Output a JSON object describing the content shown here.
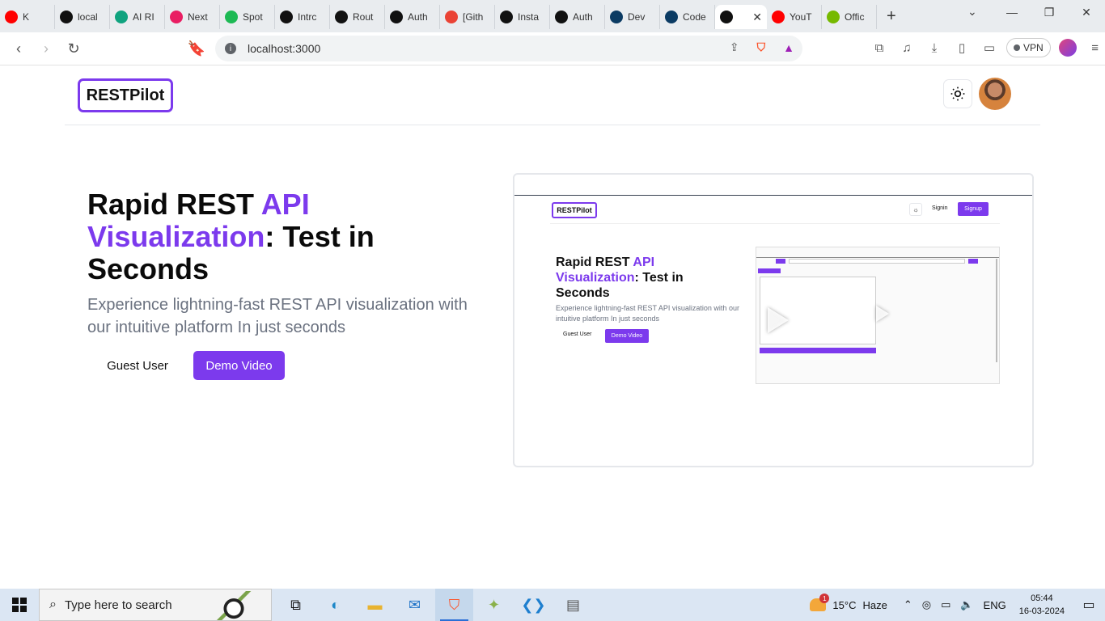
{
  "browser": {
    "tabs": [
      {
        "label": "K",
        "icon": "youtube-icon",
        "color": "#ff0000"
      },
      {
        "label": "local",
        "icon": "vercel-icon",
        "color": "#111111"
      },
      {
        "label": "AI RI",
        "icon": "openai-icon",
        "color": "#10a37f"
      },
      {
        "label": "Next",
        "icon": "play-icon",
        "color": "#e91e63"
      },
      {
        "label": "Spot",
        "icon": "spotify-icon",
        "color": "#1db954"
      },
      {
        "label": "Intrc",
        "icon": "intro-icon",
        "color": "#111111"
      },
      {
        "label": "Rout",
        "icon": "nextjs-icon",
        "color": "#111111"
      },
      {
        "label": "Auth",
        "icon": "github-icon",
        "color": "#111111"
      },
      {
        "label": "[Gith",
        "icon": "gmail-icon",
        "color": "#ea4335"
      },
      {
        "label": "Insta",
        "icon": "github-icon",
        "color": "#111111"
      },
      {
        "label": "Auth",
        "icon": "github-icon",
        "color": "#111111"
      },
      {
        "label": "Dev",
        "icon": "dev-icon",
        "color": "#0b3b63"
      },
      {
        "label": "Code",
        "icon": "dev-icon",
        "color": "#0b3b63"
      },
      {
        "label": "",
        "icon": "vercel-icon",
        "color": "#111111",
        "active": true
      },
      {
        "label": "YouT",
        "icon": "youtube-icon",
        "color": "#ff0000"
      },
      {
        "label": "Offic",
        "icon": "nvidia-icon",
        "color": "#76b900"
      }
    ],
    "new_tab": "+",
    "url": "localhost:3000",
    "vpn_label": "VPN"
  },
  "app": {
    "logo": "RESTPilot",
    "hero": {
      "title_part1": "Rapid REST ",
      "title_highlight": "API Visualization",
      "title_part2": ": Test in Seconds",
      "subtitle": "Experience lightning-fast REST API visualization with our intuitive platform In just seconds",
      "guest_button": "Guest User",
      "demo_button": "Demo Video"
    },
    "preview": {
      "logo": "RESTPilot",
      "signin": "Signin",
      "signup": "Signup",
      "title_part1": "Rapid REST ",
      "title_highlight": "API Visualization",
      "title_part2": ": Test in Seconds",
      "subtitle": "Experience lightning-fast REST API visualization with our intuitive platform In just seconds",
      "guest_button": "Guest User",
      "demo_button": "Demo Video"
    },
    "accent_color": "#7c3aed"
  },
  "taskbar": {
    "search_placeholder": "Type here to search",
    "weather_temp": "15°C",
    "weather_desc": "Haze",
    "weather_badge": "1",
    "language": "ENG",
    "time": "05:44",
    "date": "16-03-2024"
  }
}
